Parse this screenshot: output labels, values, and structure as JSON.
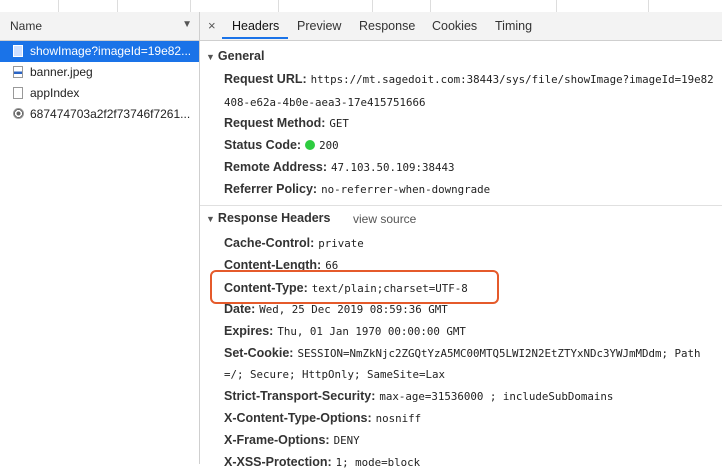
{
  "request_list": {
    "column_name": "Name",
    "sort_icon": "triangle-down",
    "items": [
      {
        "label": "showImage?imageId=19e82...",
        "icon": "image-file-icon"
      },
      {
        "label": "banner.jpeg",
        "icon": "jpeg-file-icon"
      },
      {
        "label": "appIndex",
        "icon": "document-icon"
      },
      {
        "label": "687474703a2f2f73746f7261...",
        "icon": "gear-file-icon"
      }
    ]
  },
  "tabs": {
    "close": "×",
    "items": [
      "Headers",
      "Preview",
      "Response",
      "Cookies",
      "Timing"
    ]
  },
  "general": {
    "title": "General",
    "request_url_key": "Request URL:",
    "request_url_value": "https://mt.sagedoit.com:38443/sys/file/showImage?imageId=19e82",
    "request_url_cont": "408-e62a-4b0e-aea3-17e415751666",
    "method_key": "Request Method:",
    "method_value": "GET",
    "status_key": "Status Code:",
    "status_value": "200",
    "status_color": "#2ecc40",
    "remote_key": "Remote Address:",
    "remote_value": "47.103.50.109:38443",
    "referrer_key": "Referrer Policy:",
    "referrer_value": "no-referrer-when-downgrade"
  },
  "response_headers": {
    "title": "Response Headers",
    "view_source": "view source",
    "cache_control_key": "Cache-Control:",
    "cache_control_value": "private",
    "content_length_key": "Content-Length:",
    "content_length_value": "66",
    "content_type_key": "Content-Type:",
    "content_type_value": "text/plain;charset=UTF-8",
    "date_key": "Date:",
    "date_value": "Wed, 25 Dec 2019 08:59:36 GMT",
    "expires_key": "Expires:",
    "expires_value": "Thu, 01 Jan 1970 00:00:00 GMT",
    "set_cookie_key": "Set-Cookie:",
    "set_cookie_value": "SESSION=NmZkNjc2ZGQtYzA5MC00MTQ5LWI2N2EtZTYxNDc3YWJmMDdm; Path",
    "set_cookie_cont": "=/; Secure; HttpOnly; SameSite=Lax",
    "sts_key": "Strict-Transport-Security:",
    "sts_value": "max-age=31536000 ; includeSubDomains",
    "xcto_key": "X-Content-Type-Options:",
    "xcto_value": "nosniff",
    "xfo_key": "X-Frame-Options:",
    "xfo_value": "DENY",
    "xxss_key": "X-XSS-Protection:",
    "xxss_value": "1; mode=block"
  },
  "highlight_color": "#e55a2b",
  "accent_color": "#1a73e8"
}
